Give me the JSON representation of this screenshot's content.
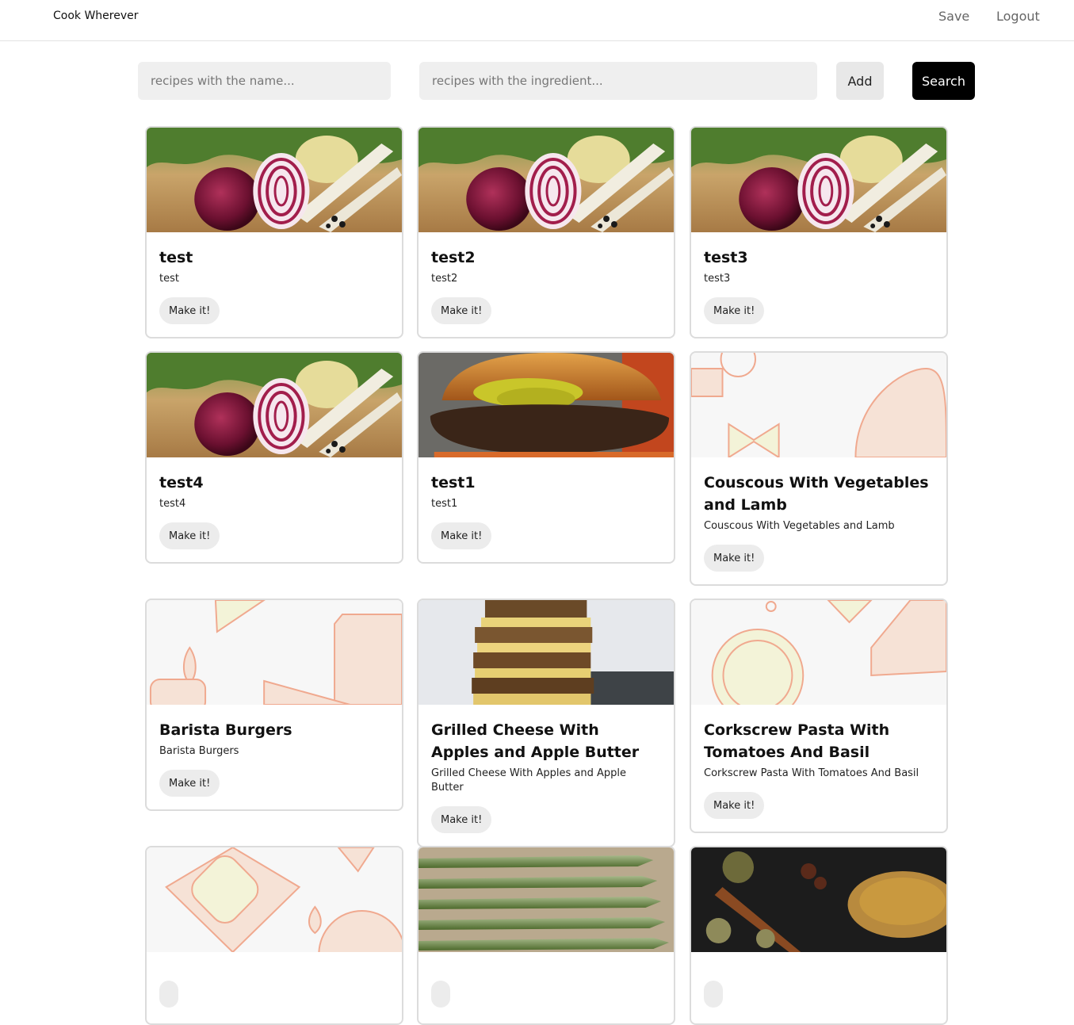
{
  "navbar": {
    "brand": "Cook Wherever",
    "links": [
      "Save",
      "Logout"
    ]
  },
  "search": {
    "name_placeholder": "recipes with the name...",
    "ingredient_placeholder": "recipes with the ingredient...",
    "add_label": "Add",
    "search_label": "Search"
  },
  "recipes": [
    {
      "title": "test",
      "description": "test",
      "button": "Make it!",
      "image": "onion-photo"
    },
    {
      "title": "test2",
      "description": "test2",
      "button": "Make it!",
      "image": "onion-photo"
    },
    {
      "title": "test3",
      "description": "test3",
      "button": "Make it!",
      "image": "onion-photo"
    },
    {
      "title": "test4",
      "description": "test4",
      "button": "Make it!",
      "image": "onion-photo"
    },
    {
      "title": "test1",
      "description": "test1",
      "button": "Make it!",
      "image": "burger-photo"
    },
    {
      "title": "Couscous With Vegetables and Lamb",
      "description": "Couscous With Vegetables and Lamb",
      "button": "Make it!",
      "image": "placeholder-pattern"
    },
    {
      "title": "Barista Burgers",
      "description": "Barista Burgers",
      "button": "Make it!",
      "image": "placeholder-pattern"
    },
    {
      "title": "Grilled Cheese With Apples and Apple Butter",
      "description": "Grilled Cheese With Apples and Apple Butter",
      "button": "Make it!",
      "image": "sandwich-photo"
    },
    {
      "title": "Corkscrew Pasta With Tomatoes And Basil",
      "description": "Corkscrew Pasta With Tomatoes And Basil",
      "button": "Make it!",
      "image": "placeholder-pattern"
    },
    {
      "title": "",
      "description": "",
      "button": "",
      "image": "placeholder-pattern"
    },
    {
      "title": "",
      "description": "",
      "button": "",
      "image": "asparagus-photo"
    },
    {
      "title": "",
      "description": "",
      "button": "",
      "image": "spices-photo"
    }
  ],
  "colors": {
    "search_button_bg": "#000000",
    "input_bg": "#efefef",
    "pill_bg": "#ececec",
    "card_border": "#dcdcdc"
  }
}
